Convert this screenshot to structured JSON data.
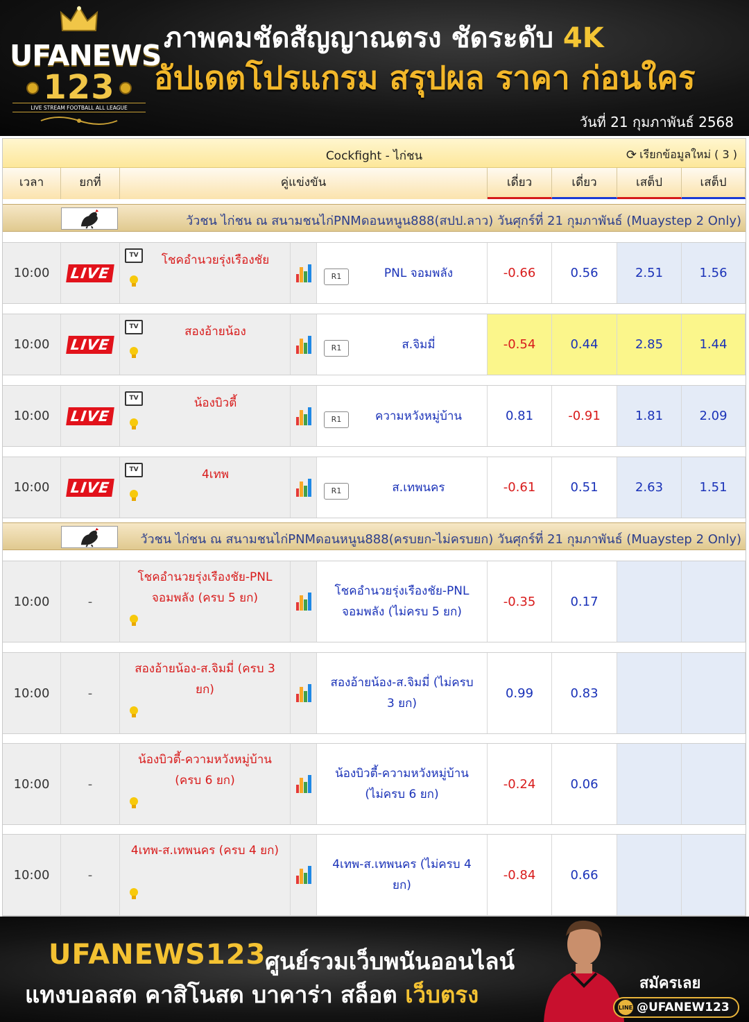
{
  "header": {
    "logo_line1": "UFANEWS",
    "logo_line2": "123",
    "logo_tagline": "LIVE STREAM FOOTBALL ALL LEAGUE",
    "headline1_main": "ภาพคมชัดสัญญาณตรง ชัดระดับ ",
    "headline1_accent": "4K",
    "headline2": "อัปเดตโปรแกรม สรุปผล ราคา ก่อนใคร",
    "date": "วันที่ 21 กุมภาพันธ์ 2568"
  },
  "table": {
    "title": "Cockfight - ไก่ชน",
    "refresh_label": "เรียกข้อมูลใหม่ ( 3 )",
    "columns": {
      "time": "เวลา",
      "round": "ยกที่",
      "match": "คู่แข่งขัน",
      "o1": "เดี่ยว",
      "o2": "เดี่ยว",
      "o3": "เสต็ป",
      "o4": "เสต็ป"
    },
    "colors": {
      "negative": "#d81b1b",
      "positive": "#1a32b8",
      "highlight": "#fbf68b",
      "step_bg": "#e4ebf7"
    },
    "sections": [
      {
        "title": "วัวชน ไก่ชน ณ สนามชนไก่PNMดอนหนูน888(สปป.ลาว) วันศุกร์ที่ 21 กุมภาพันธ์ (Muaystep 2 Only)",
        "rows": [
          {
            "time": "10:00",
            "round": "LIVE",
            "home": "โชคอำนวยรุ่งเรืองชัย",
            "tag": "R1",
            "away": "PNL จอมพลัง",
            "o1": "-0.66",
            "o2": "0.56",
            "o3": "2.51",
            "o4": "1.56"
          },
          {
            "time": "10:00",
            "round": "LIVE",
            "home": "สองอ้ายน้อง",
            "tag": "R1",
            "away": "ส.จิมมี่",
            "o1": "-0.54",
            "o2": "0.44",
            "o3": "2.85",
            "o4": "1.44"
          },
          {
            "time": "10:00",
            "round": "LIVE",
            "home": "น้องบิวตี้",
            "tag": "R1",
            "away": "ความหวังหมู่บ้าน",
            "o1": "0.81",
            "o2": "-0.91",
            "o3": "1.81",
            "o4": "2.09"
          },
          {
            "time": "10:00",
            "round": "LIVE",
            "home": "4เทพ",
            "tag": "R1",
            "away": "ส.เทพนคร",
            "o1": "-0.61",
            "o2": "0.51",
            "o3": "2.63",
            "o4": "1.51"
          }
        ]
      },
      {
        "title": "วัวชน ไก่ชน ณ สนามชนไก่PNMดอนหนูน888(ครบยก-ไม่ครบยก) วันศุกร์ที่ 21 กุมภาพันธ์ (Muaystep 2 Only)",
        "rows": [
          {
            "time": "10:00",
            "round": "-",
            "home": "โชคอำนวยรุ่งเรืองชัย-PNL จอมพลัง (ครบ 5 ยก)",
            "away": "โชคอำนวยรุ่งเรืองชัย-PNL จอมพลัง (ไม่ครบ 5 ยก)",
            "o1": "-0.35",
            "o2": "0.17"
          },
          {
            "time": "10:00",
            "round": "-",
            "home": "สองอ้ายน้อง-ส.จิมมี่ (ครบ 3 ยก)",
            "away": "สองอ้ายน้อง-ส.จิมมี่ (ไม่ครบ 3 ยก)",
            "o1": "0.99",
            "o2": "0.83"
          },
          {
            "time": "10:00",
            "round": "-",
            "home": "น้องบิวตี้-ความหวังหมู่บ้าน (ครบ 6 ยก)",
            "away": "น้องบิวตี้-ความหวังหมู่บ้าน (ไม่ครบ 6 ยก)",
            "o1": "-0.24",
            "o2": "0.06"
          },
          {
            "time": "10:00",
            "round": "-",
            "home": "4เทพ-ส.เทพนคร (ครบ 4 ยก)",
            "away": "4เทพ-ส.เทพนคร (ไม่ครบ 4 ยก)",
            "o1": "-0.84",
            "o2": "0.66"
          }
        ]
      }
    ]
  },
  "banner": {
    "brand": "UFANEWS123",
    "tagline": "ศูนย์รวมเว็บพนันออนไลน์",
    "line2_main": "แทงบอลสด คาสิโนสด บาคาร่า สล็อต ",
    "line2_accent": "เว็บตรง",
    "register": "สมัครเลย",
    "line_id": "@UFANEW123",
    "line_logo": "LINE"
  }
}
